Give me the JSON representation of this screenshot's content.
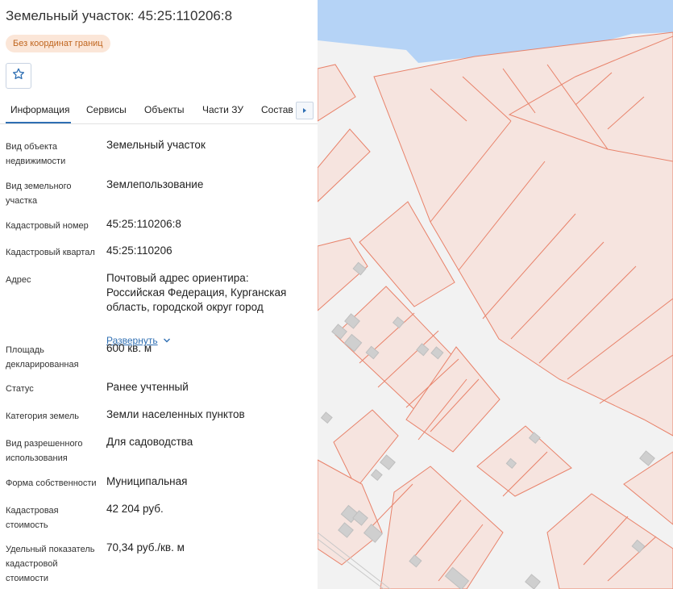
{
  "parcel": {
    "title": "Земельный участок: 45:25:110206:8",
    "badge": "Без координат границ"
  },
  "actions": {
    "favorite_icon": "star-icon"
  },
  "tabs": [
    {
      "label": "Информация",
      "active": true
    },
    {
      "label": "Сервисы",
      "active": false
    },
    {
      "label": "Объекты",
      "active": false
    },
    {
      "label": "Части ЗУ",
      "active": false
    },
    {
      "label": "Состав",
      "active": false
    }
  ],
  "tabs_scroll_icon": "chevron-right-icon",
  "info": {
    "object_type": {
      "label": "Вид объекта недвижимости",
      "value": "Земельный участок"
    },
    "land_type": {
      "label": "Вид земельного участка",
      "value": "Землепользование"
    },
    "cadastral_number": {
      "label": "Кадастровый номер",
      "value": "45:25:110206:8"
    },
    "cadastral_quarter": {
      "label": "Кадастровый квартал",
      "value": "45:25:110206"
    },
    "address": {
      "label": "Адрес",
      "value": "Почтовый адрес ориентира: Российская Федерация, Курганская область, городской округ город",
      "expand_label": "Развернуть"
    },
    "area": {
      "label": "Площадь декларированная",
      "value": "600 кв. м"
    },
    "status": {
      "label": "Статус",
      "value": "Ранее учтенный"
    },
    "land_category": {
      "label": "Категория земель",
      "value": "Земли населенных пунктов"
    },
    "permitted_use": {
      "label": "Вид разрешенного использования",
      "value": "Для садоводства"
    },
    "ownership": {
      "label": "Форма собственности",
      "value": "Муниципальная"
    },
    "cadastral_value": {
      "label": "Кадастровая стоимость",
      "value": "42 204 руб."
    },
    "specific_value": {
      "label": "Удельный показатель кадастровой стоимости",
      "value": "70,34 руб./кв. м"
    }
  },
  "colors": {
    "accent": "#2f6fb3",
    "badge_bg": "#fbe6d8",
    "badge_text": "#c0661f",
    "parcel_fill": "#f6e4df",
    "parcel_stroke": "#e8826a",
    "water": "#b5d3f6",
    "building": "#cfcfcf"
  }
}
